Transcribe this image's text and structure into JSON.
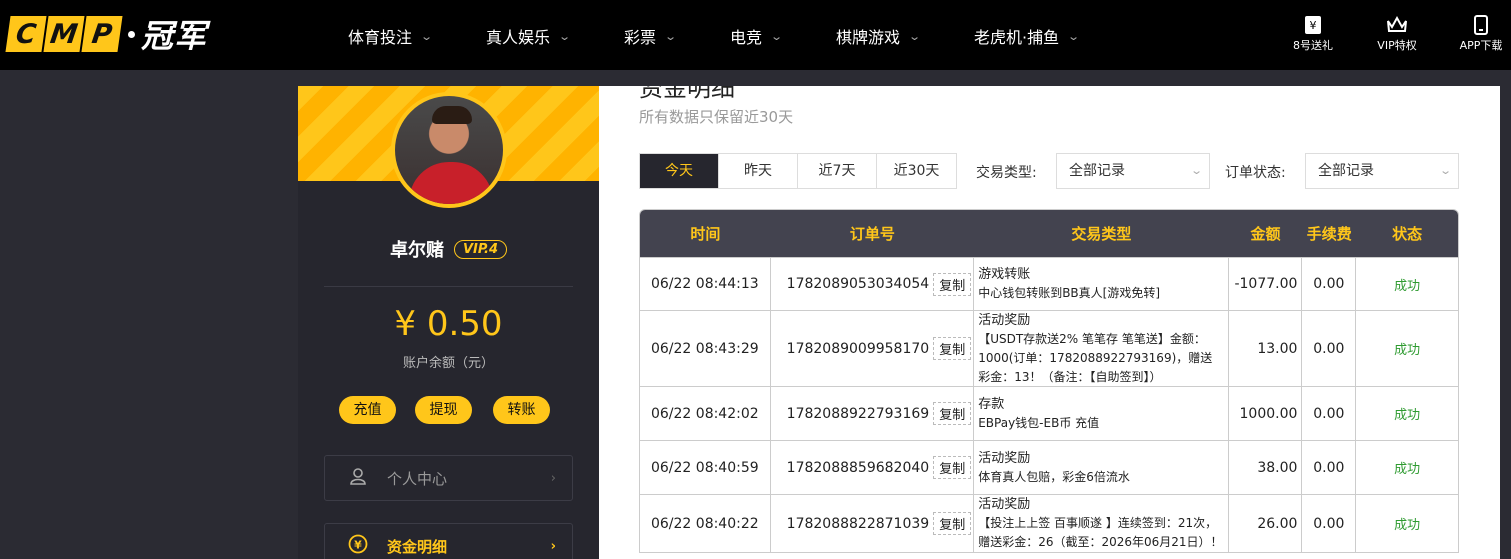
{
  "logo": {
    "letters": [
      "C",
      "M",
      "P"
    ],
    "brand": "冠军"
  },
  "nav": [
    {
      "label": "体育投注"
    },
    {
      "label": "真人娱乐"
    },
    {
      "label": "彩票"
    },
    {
      "label": "电竞"
    },
    {
      "label": "棋牌游戏"
    },
    {
      "label": "老虎机·捕鱼"
    }
  ],
  "nav_right": [
    {
      "icon": "yen-ticket-icon",
      "label": "8号送礼"
    },
    {
      "icon": "crown-icon",
      "label": "VIP特权"
    },
    {
      "icon": "phone-icon",
      "label": "APP下载"
    }
  ],
  "profile": {
    "username": "卓尔赌",
    "vip": "VIP.4",
    "balance": "¥ 0.50",
    "balance_label": "账户余额（元）",
    "actions": [
      "充值",
      "提现",
      "转账"
    ],
    "menu": [
      {
        "icon": "user-icon",
        "label": "个人中心",
        "active": false
      },
      {
        "icon": "yen-circle-icon",
        "label": "资金明细",
        "active": true
      }
    ]
  },
  "main": {
    "title": "资金明细",
    "subtitle": "所有数据只保留近30天",
    "tabs": [
      "今天",
      "昨天",
      "近7天",
      "近30天"
    ],
    "active_tab": "今天",
    "filter_type_label": "交易类型:",
    "filter_type_value": "全部记录",
    "filter_status_label": "订单状态:",
    "filter_status_value": "全部记录",
    "columns": [
      "时间",
      "订单号",
      "交易类型",
      "金额",
      "手续费",
      "状态"
    ],
    "copy_label": "复制",
    "rows": [
      {
        "time": "06/22 08:44:13",
        "order": "1782089053034054",
        "type": "游戏转账",
        "desc": "中心钱包转账到BB真人[游戏免转]",
        "amount": "-1077.00",
        "fee": "0.00",
        "status": "成功"
      },
      {
        "time": "06/22 08:43:29",
        "order": "1782089009958170",
        "type": "活动奖励",
        "desc": "【USDT存款送2% 笔笔存 笔笔送】金额：1000(订单：1782088922793169)，赠送彩金：13！（备注：【自助签到】）",
        "amount": "13.00",
        "fee": "0.00",
        "status": "成功"
      },
      {
        "time": "06/22 08:42:02",
        "order": "1782088922793169",
        "type": "存款",
        "desc": "EBPay钱包-EB币 充值",
        "amount": "1000.00",
        "fee": "0.00",
        "status": "成功"
      },
      {
        "time": "06/22 08:40:59",
        "order": "1782088859682040",
        "type": "活动奖励",
        "desc": "体育真人包赔，彩金6倍流水",
        "amount": "38.00",
        "fee": "0.00",
        "status": "成功"
      },
      {
        "time": "06/22 08:40:22",
        "order": "1782088822871039",
        "type": "活动奖励",
        "desc": "【投注上上签 百事顺遂 】连续签到：21次，赠送彩金：26（截至：2026年06月21日）！",
        "amount": "26.00",
        "fee": "0.00",
        "status": "成功"
      }
    ]
  },
  "colors": {
    "accent": "#ffc61a",
    "dark": "#26262e",
    "success": "#2f9b31"
  }
}
